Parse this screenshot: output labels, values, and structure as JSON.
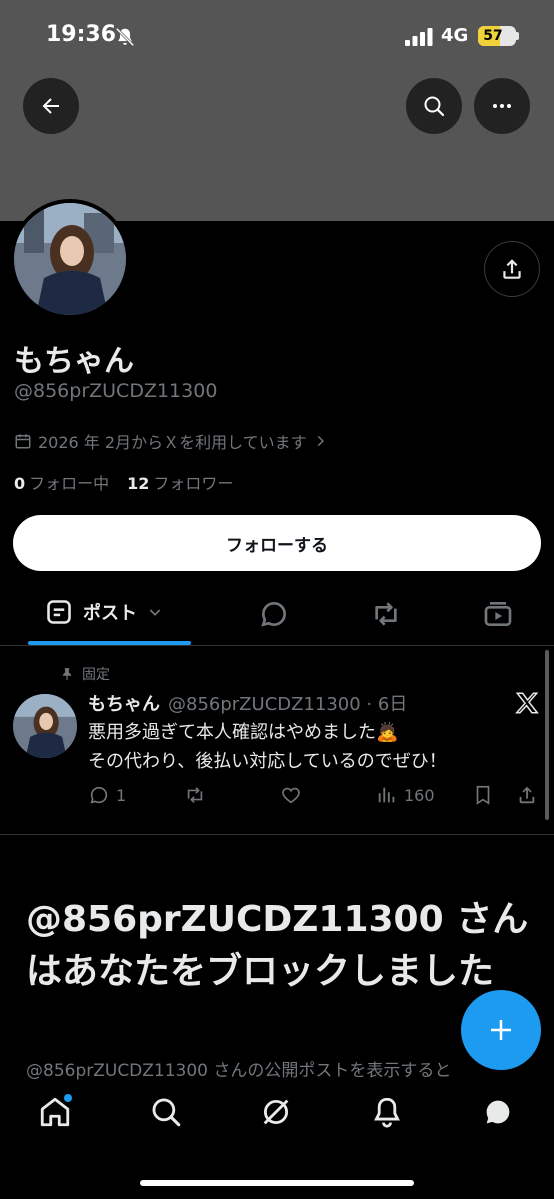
{
  "status": {
    "time": "19:36",
    "network": "4G",
    "battery": "57"
  },
  "profile": {
    "name": "もちゃん",
    "handle": "@856prZUCDZ11300",
    "joined": "2026 年 2月からＸを利用しています",
    "following_count": "0",
    "following_label": "フォロー中",
    "followers_count": "12",
    "followers_label": "フォロワー",
    "follow_button": "フォローする"
  },
  "tabs": {
    "posts_label": "ポスト"
  },
  "pinned_post": {
    "pinned_label": "固定",
    "author": "もちゃん",
    "meta": "@856prZUCDZ11300 · 6日",
    "line1": "悪用多過ぎて本人確認はやめました🙇",
    "line2": "その代わり、後払い対応しているのでぜひ！",
    "replies": "1",
    "views": "160"
  },
  "blocked": {
    "title": "@856prZUCDZ11300 さんはあなたをブロックしました",
    "subtitle": "@856prZUCDZ11300 さんの公開ポストを表示すると"
  },
  "colors": {
    "accent": "#1d9bf0",
    "banner": "#555555",
    "muted": "#71767b"
  }
}
